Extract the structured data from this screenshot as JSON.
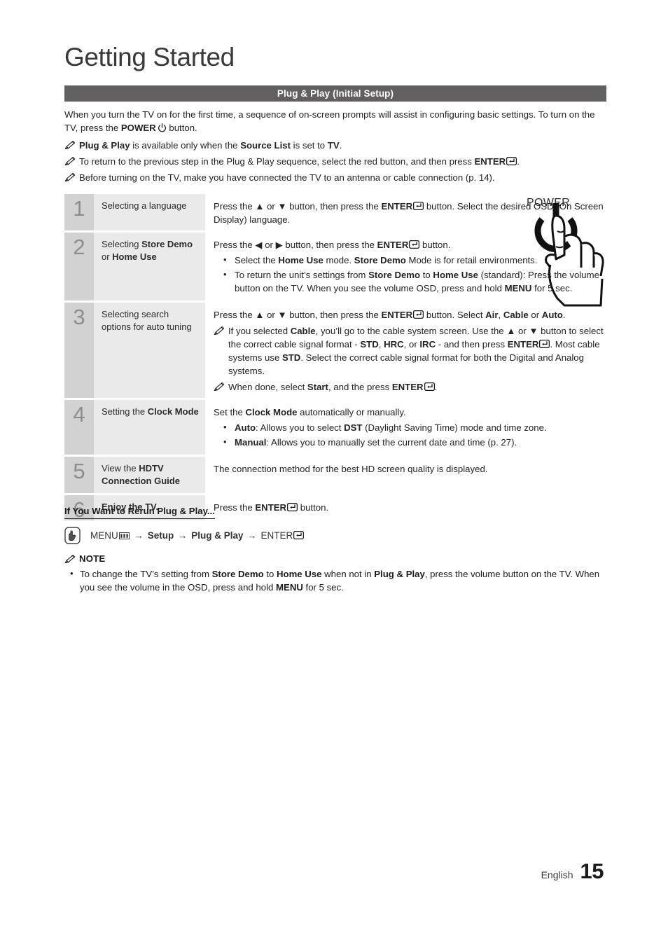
{
  "page": {
    "title": "Getting Started",
    "section_header": "Plug & Play (Initial Setup)",
    "footer_language": "English",
    "footer_page_number": "15"
  },
  "intro": {
    "text_1": "When you turn the TV on for the first time, a sequence of on-screen prompts will assist in configuring basic settings. To turn on the TV, press the ",
    "power_bold": "POWER",
    "text_2": " button."
  },
  "top_notes": [
    {
      "icon": "pencil-icon",
      "segments": [
        {
          "text": "Plug & Play",
          "bold": true
        },
        {
          "text": " is available only when the ",
          "bold": false
        },
        {
          "text": "Source List",
          "bold": true
        },
        {
          "text": " is set to ",
          "bold": false
        },
        {
          "text": "TV",
          "bold": true
        },
        {
          "text": ".",
          "bold": false
        }
      ]
    },
    {
      "icon": "pencil-icon",
      "segments": [
        {
          "text": "To return to the previous step in the Plug & Play sequence, select the red button, and then press ",
          "bold": false
        },
        {
          "text": "ENTER",
          "bold": true
        },
        {
          "text": "ENTER_KEY",
          "icon": true
        },
        {
          "text": ".",
          "bold": false
        }
      ]
    },
    {
      "icon": "pencil-icon",
      "segments": [
        {
          "text": "Before turning on the TV, make you have connected the TV to an antenna or cable connection (p. 14).",
          "bold": false
        }
      ]
    }
  ],
  "power_illustration": {
    "label": "POWER",
    "icon": "power-button-hand-press-icon"
  },
  "steps": [
    {
      "number": "1",
      "title_segments": [
        {
          "text": "Selecting a language",
          "bold": false
        }
      ],
      "body": {
        "lead_segments": [
          {
            "text": "Press the ",
            "bold": false
          },
          {
            "text": "▲",
            "bold": false
          },
          {
            "text": " or ",
            "bold": false
          },
          {
            "text": "▼",
            "bold": false
          },
          {
            "text": " button, then press the ",
            "bold": false
          },
          {
            "text": "ENTER",
            "bold": true
          },
          {
            "text": "ENTER_KEY",
            "icon": true
          },
          {
            "text": " button. Select the desired OSD (On Screen Display) language.",
            "bold": false
          }
        ],
        "bullets": [],
        "subnotes": []
      }
    },
    {
      "number": "2",
      "title_segments": [
        {
          "text": "Selecting ",
          "bold": false
        },
        {
          "text": "Store Demo",
          "bold": true
        },
        {
          "text": " or ",
          "bold": false
        },
        {
          "text": "Home Use",
          "bold": true
        }
      ],
      "body": {
        "lead_segments": [
          {
            "text": "Press the ",
            "bold": false
          },
          {
            "text": "◀",
            "bold": false
          },
          {
            "text": " or ",
            "bold": false
          },
          {
            "text": "▶",
            "bold": false
          },
          {
            "text": " button, then press the ",
            "bold": false
          },
          {
            "text": "ENTER",
            "bold": true
          },
          {
            "text": "ENTER_KEY",
            "icon": true
          },
          {
            "text": " button.",
            "bold": false
          }
        ],
        "bullets": [
          [
            {
              "text": "Select the ",
              "bold": false
            },
            {
              "text": "Home Use",
              "bold": true
            },
            {
              "text": " mode. ",
              "bold": false
            },
            {
              "text": "Store Demo",
              "bold": true
            },
            {
              "text": " Mode is for retail environments.",
              "bold": false
            }
          ],
          [
            {
              "text": "To return the unit’s settings from ",
              "bold": false
            },
            {
              "text": "Store Demo",
              "bold": true
            },
            {
              "text": " to ",
              "bold": false
            },
            {
              "text": "Home Use",
              "bold": true
            },
            {
              "text": " (standard): Press the volume button on the TV. When you see the volume OSD, press and hold ",
              "bold": false
            },
            {
              "text": "MENU",
              "bold": true
            },
            {
              "text": " for 5 sec.",
              "bold": false
            }
          ]
        ],
        "subnotes": []
      }
    },
    {
      "number": "3",
      "title_segments": [
        {
          "text": "Selecting search options for auto tuning",
          "bold": false
        }
      ],
      "body": {
        "lead_segments": [
          {
            "text": "Press the ",
            "bold": false
          },
          {
            "text": "▲",
            "bold": false
          },
          {
            "text": " or ",
            "bold": false
          },
          {
            "text": "▼",
            "bold": false
          },
          {
            "text": " button, then press the ",
            "bold": false
          },
          {
            "text": "ENTER",
            "bold": true
          },
          {
            "text": "ENTER_KEY",
            "icon": true
          },
          {
            "text": " button. Select ",
            "bold": false
          },
          {
            "text": "Air",
            "bold": true
          },
          {
            "text": ", ",
            "bold": false
          },
          {
            "text": "Cable",
            "bold": true
          },
          {
            "text": " or ",
            "bold": false
          },
          {
            "text": "Auto",
            "bold": true
          },
          {
            "text": ".",
            "bold": false
          }
        ],
        "bullets": [],
        "subnotes": [
          [
            {
              "text": "If you selected ",
              "bold": false
            },
            {
              "text": "Cable",
              "bold": true
            },
            {
              "text": ", you’ll go to the cable system screen. Use the ",
              "bold": false
            },
            {
              "text": "▲",
              "bold": false
            },
            {
              "text": " or ",
              "bold": false
            },
            {
              "text": "▼",
              "bold": false
            },
            {
              "text": " button to select the correct cable signal format - ",
              "bold": false
            },
            {
              "text": "STD",
              "bold": true
            },
            {
              "text": ", ",
              "bold": false
            },
            {
              "text": "HRC",
              "bold": true
            },
            {
              "text": ", or ",
              "bold": false
            },
            {
              "text": "IRC",
              "bold": true
            },
            {
              "text": " - and then press ",
              "bold": false
            },
            {
              "text": "ENTER",
              "bold": true
            },
            {
              "text": "ENTER_KEY",
              "icon": true
            },
            {
              "text": ". Most cable systems use ",
              "bold": false
            },
            {
              "text": "STD",
              "bold": true
            },
            {
              "text": ". Select the correct cable signal format for both the Digital and Analog systems.",
              "bold": false
            }
          ],
          [
            {
              "text": "When done, select ",
              "bold": false
            },
            {
              "text": "Start",
              "bold": true
            },
            {
              "text": ", and the press ",
              "bold": false
            },
            {
              "text": "ENTER",
              "bold": true
            },
            {
              "text": "ENTER_KEY",
              "icon": true
            },
            {
              "text": ".",
              "bold": false
            }
          ]
        ]
      }
    },
    {
      "number": "4",
      "title_segments": [
        {
          "text": "Setting the ",
          "bold": false
        },
        {
          "text": "Clock Mode",
          "bold": true
        }
      ],
      "body": {
        "lead_segments": [
          {
            "text": "Set the ",
            "bold": false
          },
          {
            "text": "Clock Mode",
            "bold": true
          },
          {
            "text": " automatically or manually.",
            "bold": false
          }
        ],
        "bullets": [
          [
            {
              "text": "Auto",
              "bold": true
            },
            {
              "text": ": Allows you to select ",
              "bold": false
            },
            {
              "text": "DST",
              "bold": true
            },
            {
              "text": " (Daylight Saving Time) mode and time zone.",
              "bold": false
            }
          ],
          [
            {
              "text": "Manual",
              "bold": true
            },
            {
              "text": ": Allows you to manually set the current date and time (p. 27).",
              "bold": false
            }
          ]
        ],
        "subnotes": []
      }
    },
    {
      "number": "5",
      "title_segments": [
        {
          "text": "View the ",
          "bold": false
        },
        {
          "text": "HDTV Connection Guide",
          "bold": true
        }
      ],
      "body": {
        "lead_segments": [
          {
            "text": "The connection method for the best HD screen quality is displayed.",
            "bold": false
          }
        ],
        "bullets": [],
        "subnotes": []
      }
    },
    {
      "number": "6",
      "title_segments": [
        {
          "text": "Enjoy the TV.",
          "bold": true
        }
      ],
      "body": {
        "lead_segments": [
          {
            "text": "Press the ",
            "bold": false
          },
          {
            "text": "ENTER",
            "bold": true
          },
          {
            "text": "ENTER_KEY",
            "icon": true
          },
          {
            "text": " button.",
            "bold": false
          }
        ],
        "bullets": [],
        "subnotes": []
      }
    }
  ],
  "rerun": {
    "heading": "If You Want to Rerun Plug & Play...",
    "path_segments": [
      {
        "text": "MENU",
        "bold": false
      },
      {
        "text": "MENU_BARS",
        "icon": true
      },
      {
        "text": "ARROW",
        "arrow": true
      },
      {
        "text": "Setup",
        "bold": true
      },
      {
        "text": "ARROW",
        "arrow": true
      },
      {
        "text": "Plug & Play",
        "bold": true
      },
      {
        "text": "ARROW",
        "arrow": true
      },
      {
        "text": "ENTER",
        "bold": false
      },
      {
        "text": "ENTER_KEY",
        "icon": true
      }
    ]
  },
  "note_block": {
    "heading": "NOTE",
    "icon": "pencil-icon",
    "items": [
      [
        {
          "text": "To change the TV’s setting from ",
          "bold": false
        },
        {
          "text": "Store Demo",
          "bold": true
        },
        {
          "text": " to ",
          "bold": false
        },
        {
          "text": "Home Use",
          "bold": true
        },
        {
          "text": " when not in ",
          "bold": false
        },
        {
          "text": "Plug & Play",
          "bold": true
        },
        {
          "text": ", press the volume button on the TV. When you see the volume in the OSD, press and hold ",
          "bold": false
        },
        {
          "text": "MENU",
          "bold": true
        },
        {
          "text": " for 5 sec.",
          "bold": false
        }
      ]
    ]
  },
  "colors": {
    "section_bar": "#615f5f",
    "step_number_bg": "#d2d2d2",
    "step_title_bg": "#eaeaea",
    "text": "#232323"
  }
}
